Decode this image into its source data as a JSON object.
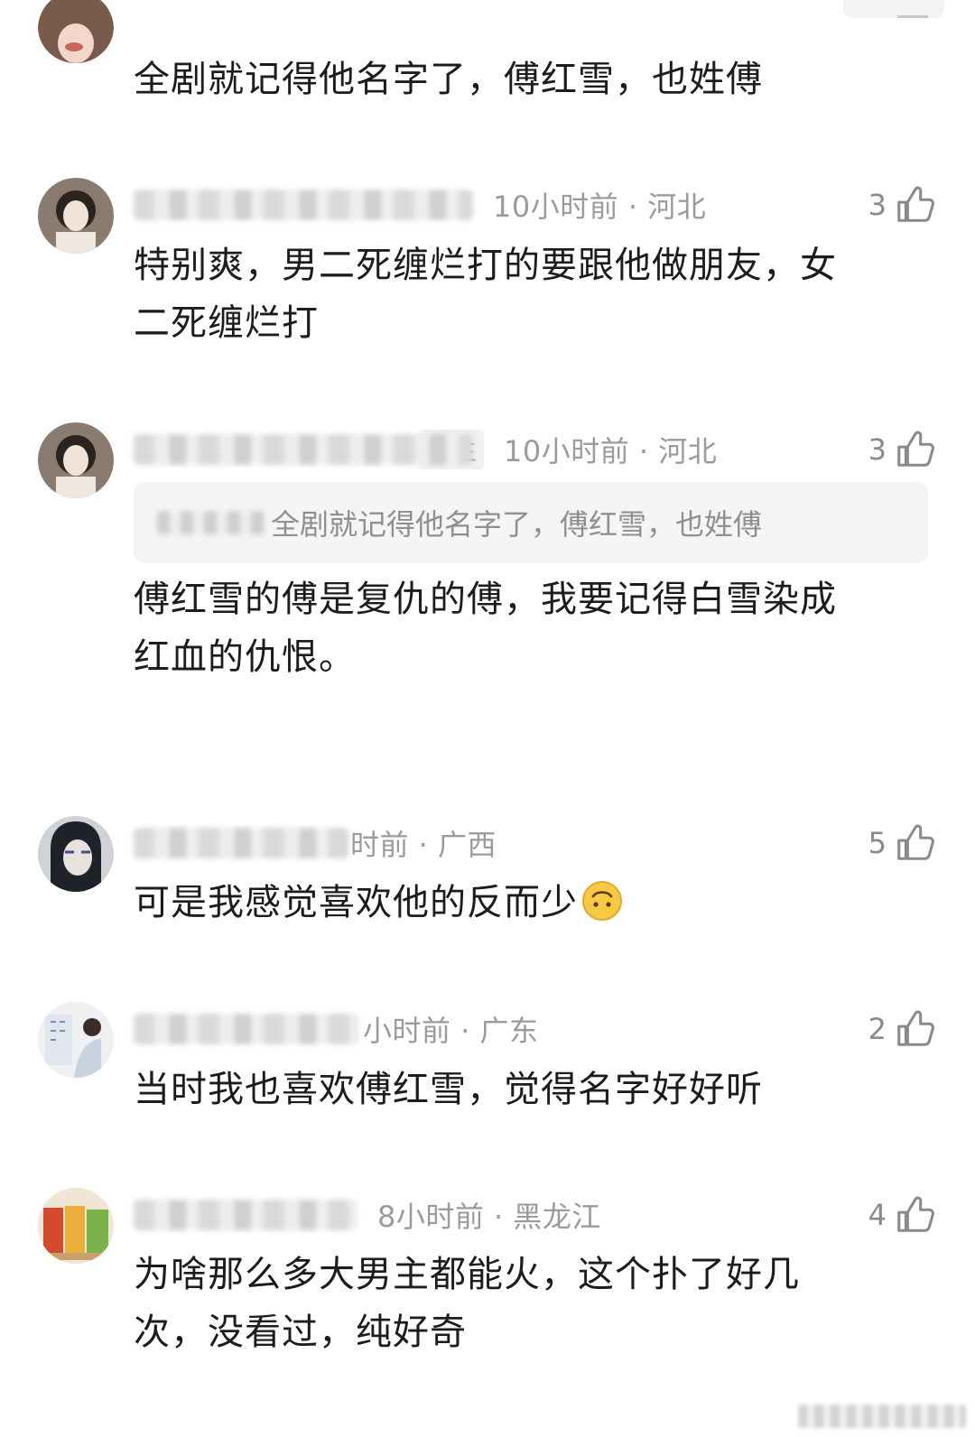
{
  "comments": [
    {
      "body": "全剧就记得他名字了，傅红雪，也姓傅"
    },
    {
      "meta": "10小时前 · 河北",
      "likes": "3",
      "body_lines": [
        "特别爽，男二死缠烂打的要跟他做朋友，女",
        "二死缠烂打"
      ]
    },
    {
      "tag": "楼主",
      "meta": "10小时前 · 河北",
      "likes": "3",
      "quote": "全剧就记得他名字了，傅红雪，也姓傅",
      "body_lines": [
        "傅红雪的傅是复仇的傅，我要记得白雪染成",
        "红血的仇恨。"
      ]
    },
    {
      "meta": "时前 · 广西",
      "likes": "5",
      "body": "可是我感觉喜欢他的反而少",
      "emoji": "upside-down-face"
    },
    {
      "meta": "小时前 · 广东",
      "likes": "2",
      "body": "当时我也喜欢傅红雪，觉得名字好好听"
    },
    {
      "meta": "8小时前 · 黑龙江",
      "likes": "4",
      "body_lines": [
        "为啥那么多大男主都能火，这个扑了好几",
        "次，没看过，纯好奇"
      ]
    }
  ],
  "icons": {
    "like": "thumbs-up-icon"
  },
  "colors": {
    "meta": "#9b9b9b",
    "body": "#1c1c1c",
    "quote_bg": "#f5f5f5"
  }
}
